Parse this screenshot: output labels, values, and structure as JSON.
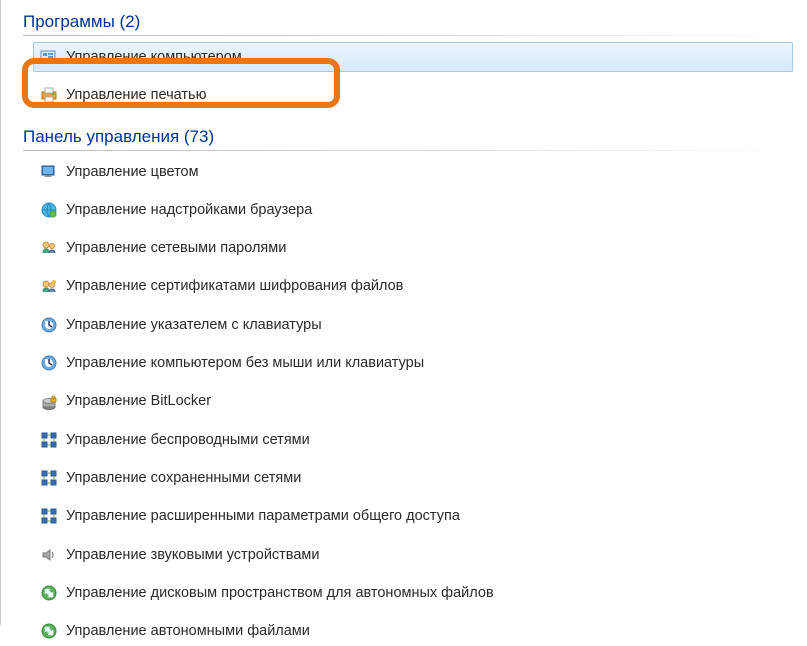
{
  "sections": [
    {
      "title": "Программы (2)",
      "items": [
        {
          "label": "Управление компьютером",
          "icon": "computer-mgmt-icon",
          "selected": true
        },
        {
          "label": "Управление печатью",
          "icon": "printer-icon",
          "selected": false
        }
      ]
    },
    {
      "title": "Панель управления (73)",
      "items": [
        {
          "label": "Управление цветом",
          "icon": "color-icon"
        },
        {
          "label": "Управление надстройками браузера",
          "icon": "browser-addons-icon"
        },
        {
          "label": "Управление сетевыми паролями",
          "icon": "network-passwords-icon"
        },
        {
          "label": "Управление сертификатами шифрования файлов",
          "icon": "certificates-icon"
        },
        {
          "label": "Управление указателем с клавиатуры",
          "icon": "mouse-keyboard-icon"
        },
        {
          "label": "Управление компьютером без мыши или клавиатуры",
          "icon": "accessibility-icon"
        },
        {
          "label": "Управление BitLocker",
          "icon": "bitlocker-icon"
        },
        {
          "label": "Управление беспроводными сетями",
          "icon": "wireless-icon"
        },
        {
          "label": "Управление сохраненными сетями",
          "icon": "saved-networks-icon"
        },
        {
          "label": "Управление расширенными параметрами общего доступа",
          "icon": "sharing-icon"
        },
        {
          "label": "Управление звуковыми устройствами",
          "icon": "sound-icon"
        },
        {
          "label": "Управление дисковым пространством для автономных файлов",
          "icon": "disk-space-icon"
        },
        {
          "label": "Управление автономными файлами",
          "icon": "offline-files-icon"
        }
      ]
    }
  ]
}
